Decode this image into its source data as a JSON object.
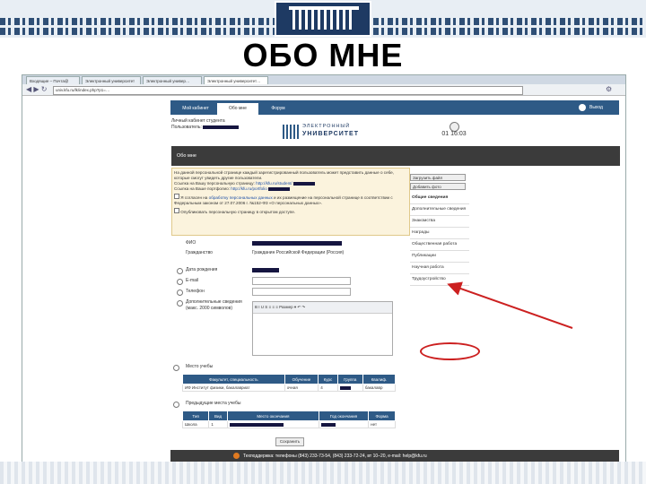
{
  "slide": {
    "title": "ОБО МНЕ"
  },
  "browser": {
    "tabs": [
      "Входящие – Почта@",
      "Электронный университет",
      "Электронный универ…",
      "Электронный университет…"
    ],
    "url": "univ.kfu.ru/lk/index.php?p1=…"
  },
  "nav": {
    "tabs": [
      "Мой кабинет",
      "Обо мне",
      "Форум"
    ],
    "exit_label": "Выход"
  },
  "header": {
    "cabinet_label": "Личный кабинет студента",
    "user_label": "Пользователь:",
    "logo_line1": "ЭЛЕКТРОННЫЙ",
    "logo_line2": "УНИВЕРСИТЕТ",
    "time": "01 16:03"
  },
  "section_title": "Обо мне",
  "notice": {
    "p1": "На данной персональной странице каждый зарегистрированный пользователь может представить данные о себе, которые смогут увидеть другие пользователи.",
    "p1b": "Ссылка на Вашу персональную страницу:",
    "link1": "http://kfu.ru/student/",
    "p2": "Ссылка на Ваше портфолио:",
    "link2": "http://kfu.ru/portfolio",
    "p3": "Я согласен на",
    "link3": "обработку персональных данных",
    "p3b": "и их размещение на персональной странице в соответствии с Федеральным законом от 27.07.2006 г. №152-ФЗ «О персональных данных».",
    "p4": "Опубликовать персональную страницу в открытом доступе."
  },
  "side_buttons": [
    "Загрузить файл",
    "Добавить фото"
  ],
  "side_menu": [
    "Общие сведения",
    "Дополнительные сведения",
    "Знакомства",
    "Награды",
    "Общественная работа",
    "Публикации",
    "Научная работа",
    "Трудоустройство"
  ],
  "form": {
    "fields": [
      {
        "label": "ФИО",
        "value": ""
      },
      {
        "label": "Гражданство",
        "value": "Гражданин Российской Федерации (Россия)"
      },
      {
        "label": "Дата рождения",
        "value": ""
      },
      {
        "label": "E-mail",
        "value": ""
      },
      {
        "label": "Телефон",
        "value": ""
      },
      {
        "label": "Дополнительные сведения (макс. 2000 символов)",
        "value": ""
      }
    ],
    "editor_toolbar": "B I U S ≡ ≡ ≡ Размер ▾ ↶ ↷"
  },
  "study": {
    "title": "Место учебы",
    "headers": [
      "Факультет, специальность",
      "Обучение",
      "Курс",
      "Группа",
      "Квалиф."
    ],
    "row": [
      "ИФ Институт физики, бакалавриат",
      "очная",
      "4",
      "",
      "бакалавр"
    ]
  },
  "prev_study": {
    "title": "Предыдущие места учебы",
    "headers": [
      "Тип",
      "Вид",
      "Место окончания",
      "Год окончания",
      "Форма"
    ],
    "row": [
      "Школа",
      "1",
      "",
      "",
      "нет"
    ]
  },
  "save_label": "Сохранить",
  "footer_text": "Техподдержка: телефоны (843) 233-73-54, (843) 233-72-24, вт 10–20, e-mail: help@kfu.ru"
}
